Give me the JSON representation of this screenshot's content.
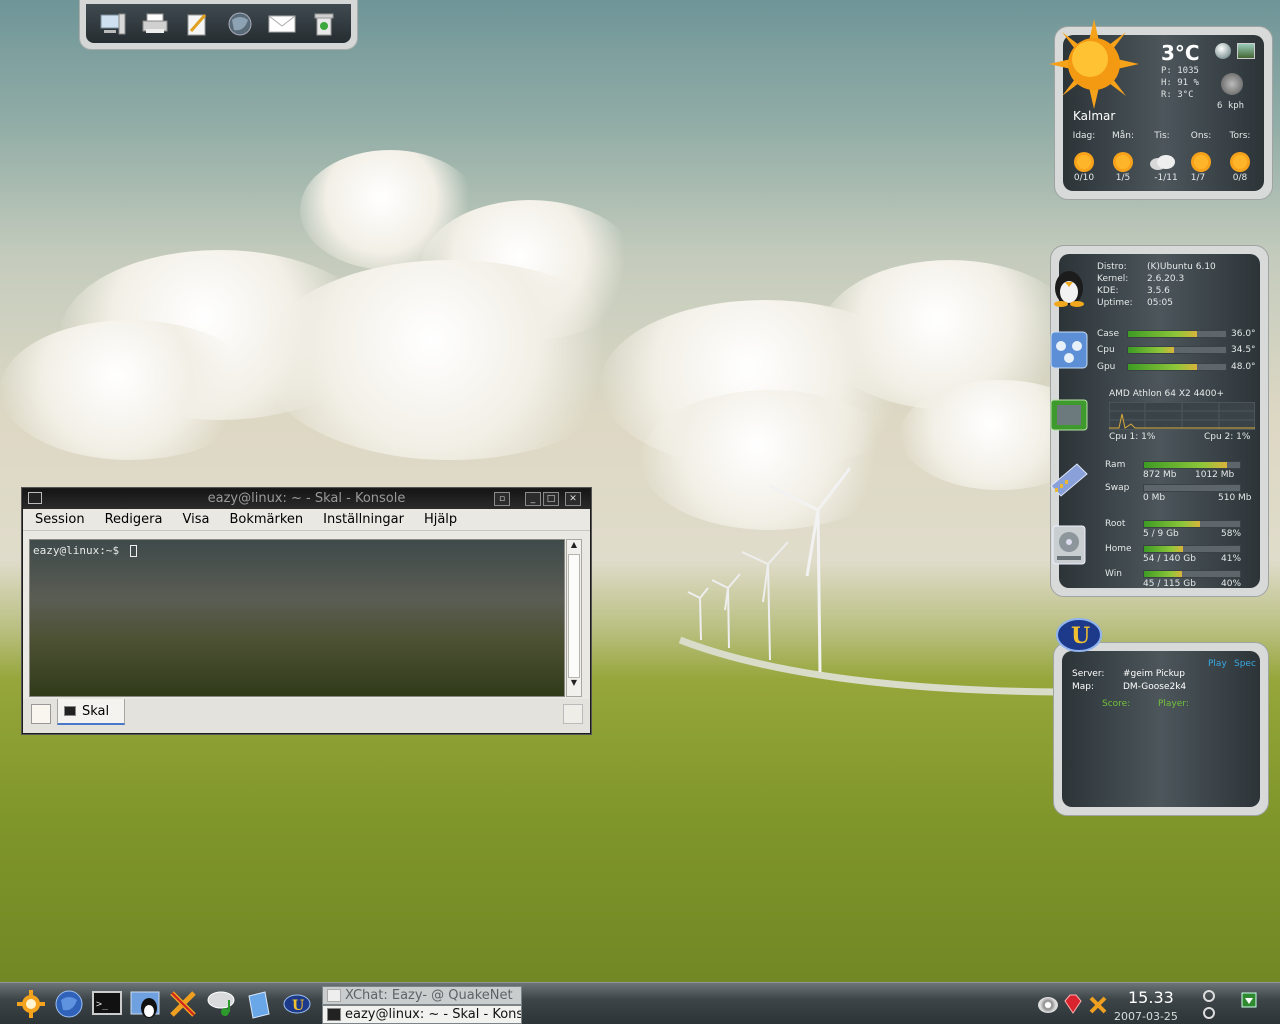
{
  "top_launcher": {
    "icons": [
      "computer-icon",
      "printer-icon",
      "notes-icon",
      "browser-icon",
      "mail-icon",
      "trash-icon"
    ]
  },
  "weather": {
    "temperature": "3°C",
    "pressure": "P: 1035",
    "humidity": "H: 91 %",
    "realfeel": "R: 3°C",
    "wind": "6 kph",
    "city": "Kalmar",
    "days": [
      {
        "label": "Idag:",
        "range": "0/10",
        "icon": "sun-icon"
      },
      {
        "label": "Mån:",
        "range": "1/5",
        "icon": "sun-icon"
      },
      {
        "label": "Tis:",
        "range": "-1/11",
        "icon": "cloud-icon"
      },
      {
        "label": "Ons:",
        "range": "1/7",
        "icon": "sun-icon"
      },
      {
        "label": "Tors:",
        "range": "0/8",
        "icon": "sun-icon"
      }
    ]
  },
  "sysinfo": {
    "distro_label": "Distro:",
    "distro": "(K)Ubuntu 6.10",
    "kernel_label": "Kernel:",
    "kernel": "2.6.20.3",
    "kde_label": "KDE:",
    "kde": "3.5.6",
    "uptime_label": "Uptime:",
    "uptime": "05:05",
    "temps": [
      {
        "label": "Case",
        "value": "36.0°",
        "level": 0.7
      },
      {
        "label": "Cpu",
        "value": "34.5°",
        "level": 0.47
      },
      {
        "label": "Gpu",
        "value": "48.0°",
        "level": 0.7
      }
    ],
    "cpu_model": "AMD Athlon 64 X2 4400+",
    "cpu1": "Cpu 1: 1%",
    "cpu2": "Cpu 2: 1%",
    "ram_label": "Ram",
    "ram_used": "872 Mb",
    "ram_total": "1012 Mb",
    "ram_level": 0.86,
    "swap_label": "Swap",
    "swap_used": "0 Mb",
    "swap_total": "510 Mb",
    "swap_level": 0.0,
    "disks": [
      {
        "label": "Root",
        "usage": "5 / 9 Gb",
        "percent": "58%",
        "level": 0.58
      },
      {
        "label": "Home",
        "usage": "54 / 140 Gb",
        "percent": "41%",
        "level": 0.41
      },
      {
        "label": "Win",
        "usage": "45 / 115 Gb",
        "percent": "40%",
        "level": 0.4
      }
    ]
  },
  "game": {
    "play": "Play",
    "spec": "Spec",
    "server_label": "Server:",
    "server": "#geim Pickup",
    "map_label": "Map:",
    "map": "DM-Goose2k4",
    "score_label": "Score:",
    "player_label": "Player:"
  },
  "konsole": {
    "title": "eazy@linux: ~ - Skal - Konsole",
    "menu": [
      "Session",
      "Redigera",
      "Visa",
      "Bokmärken",
      "Inställningar",
      "Hjälp"
    ],
    "prompt": "eazy@linux:~$",
    "tab_label": "Skal"
  },
  "taskbar": {
    "launchers": [
      "kmenu-icon",
      "browser-globe-icon",
      "terminal-icon",
      "tux-icon",
      "xchat-icon",
      "music-icon",
      "files-icon",
      "unreal-icon"
    ],
    "tasks": [
      "XChat: Eazy- @ QuakeNet",
      "eazy@linux: ~ - Skal - Konsole"
    ],
    "time": "15.33",
    "date": "2007-03-25"
  },
  "colors": {
    "panel_dark": "#2c3438",
    "frame": "#d7dad9",
    "bar_fill": "#8ec63a",
    "game_accent": "#3aa8e0",
    "game_green": "#74c23b"
  }
}
